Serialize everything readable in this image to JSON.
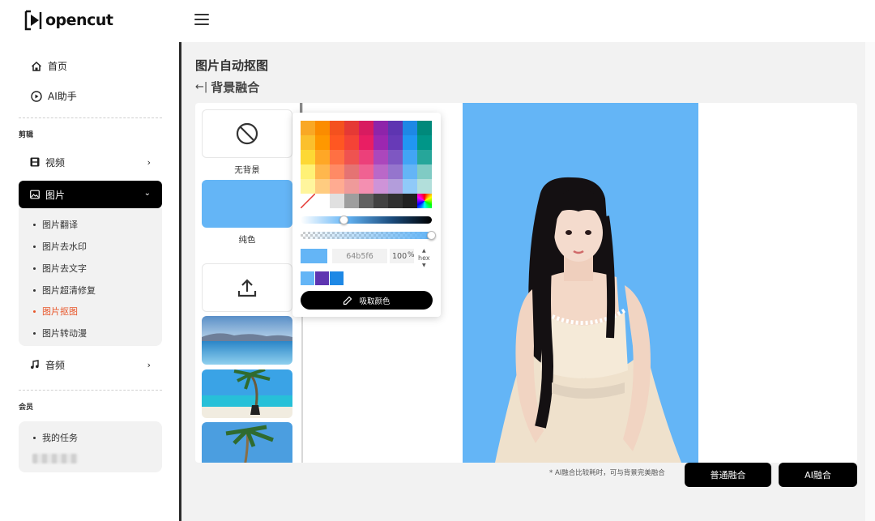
{
  "app": {
    "logo_text": "opencut"
  },
  "sidebar": {
    "home_label": "首页",
    "ai_label": "AI助手",
    "section_edit": "剪辑",
    "video_label": "视频",
    "image_label": "图片",
    "image_sub": [
      "图片翻译",
      "图片去水印",
      "图片去文字",
      "图片超清修复",
      "图片抠图",
      "图片转动漫"
    ],
    "audio_label": "音频",
    "section_member": "会员",
    "my_tasks_label": "我的任务"
  },
  "main": {
    "title": "图片自动抠图",
    "back_label": "背景融合",
    "options": {
      "no_bg": "无背景",
      "solid": "纯色"
    }
  },
  "picker": {
    "hex_value": "64b5f6",
    "alpha_value": "100",
    "alpha_unit": "%",
    "format_label": "hex",
    "eyedropper_label": "吸取颜色",
    "current_color": "#64b5f6",
    "hue_position": 0.33,
    "alpha_position": 1.0,
    "swatches": [
      [
        "#f9a825",
        "#fb8c00",
        "#f4511e",
        "#e53935",
        "#d81b60",
        "#8e24aa",
        "#5e35b1",
        "#1e88e5",
        "#00897b",
        "#43a047"
      ],
      [
        "#fbc02d",
        "#ff9800",
        "#ff5722",
        "#f44336",
        "#e91e63",
        "#9c27b0",
        "#673ab7",
        "#2196f3",
        "#009688",
        "#4caf50"
      ],
      [
        "#fdd835",
        "#ffa726",
        "#ff7043",
        "#ef5350",
        "#ec407a",
        "#ab47bc",
        "#7e57c2",
        "#42a5f5",
        "#26a69a",
        "#66bb6a"
      ],
      [
        "#fff176",
        "#ffb74d",
        "#ff8a65",
        "#e57373",
        "#f06292",
        "#ba68c8",
        "#9575cd",
        "#64b5f6",
        "#80cbc4",
        "#a5d6a7"
      ],
      [
        "#fff59d",
        "#ffcc80",
        "#ffab91",
        "#ef9a9a",
        "#f48fb1",
        "#ce93d8",
        "#b39ddb",
        "#90caf9",
        "#b2dfdb",
        "#c8e6c9"
      ]
    ],
    "gray_swatches": [
      "#ffffff",
      "#e0e0e0",
      "#9e9e9e",
      "#616161",
      "#424242",
      "#303030",
      "#212121",
      "#000000"
    ],
    "recent_colors": [
      "#64b5f6",
      "#5e35b1",
      "#1e88e5"
    ]
  },
  "footer": {
    "hint": "* AI融合比较耗时，可与背景完美融合",
    "normal_blend": "普通融合",
    "ai_blend": "AI融合"
  }
}
